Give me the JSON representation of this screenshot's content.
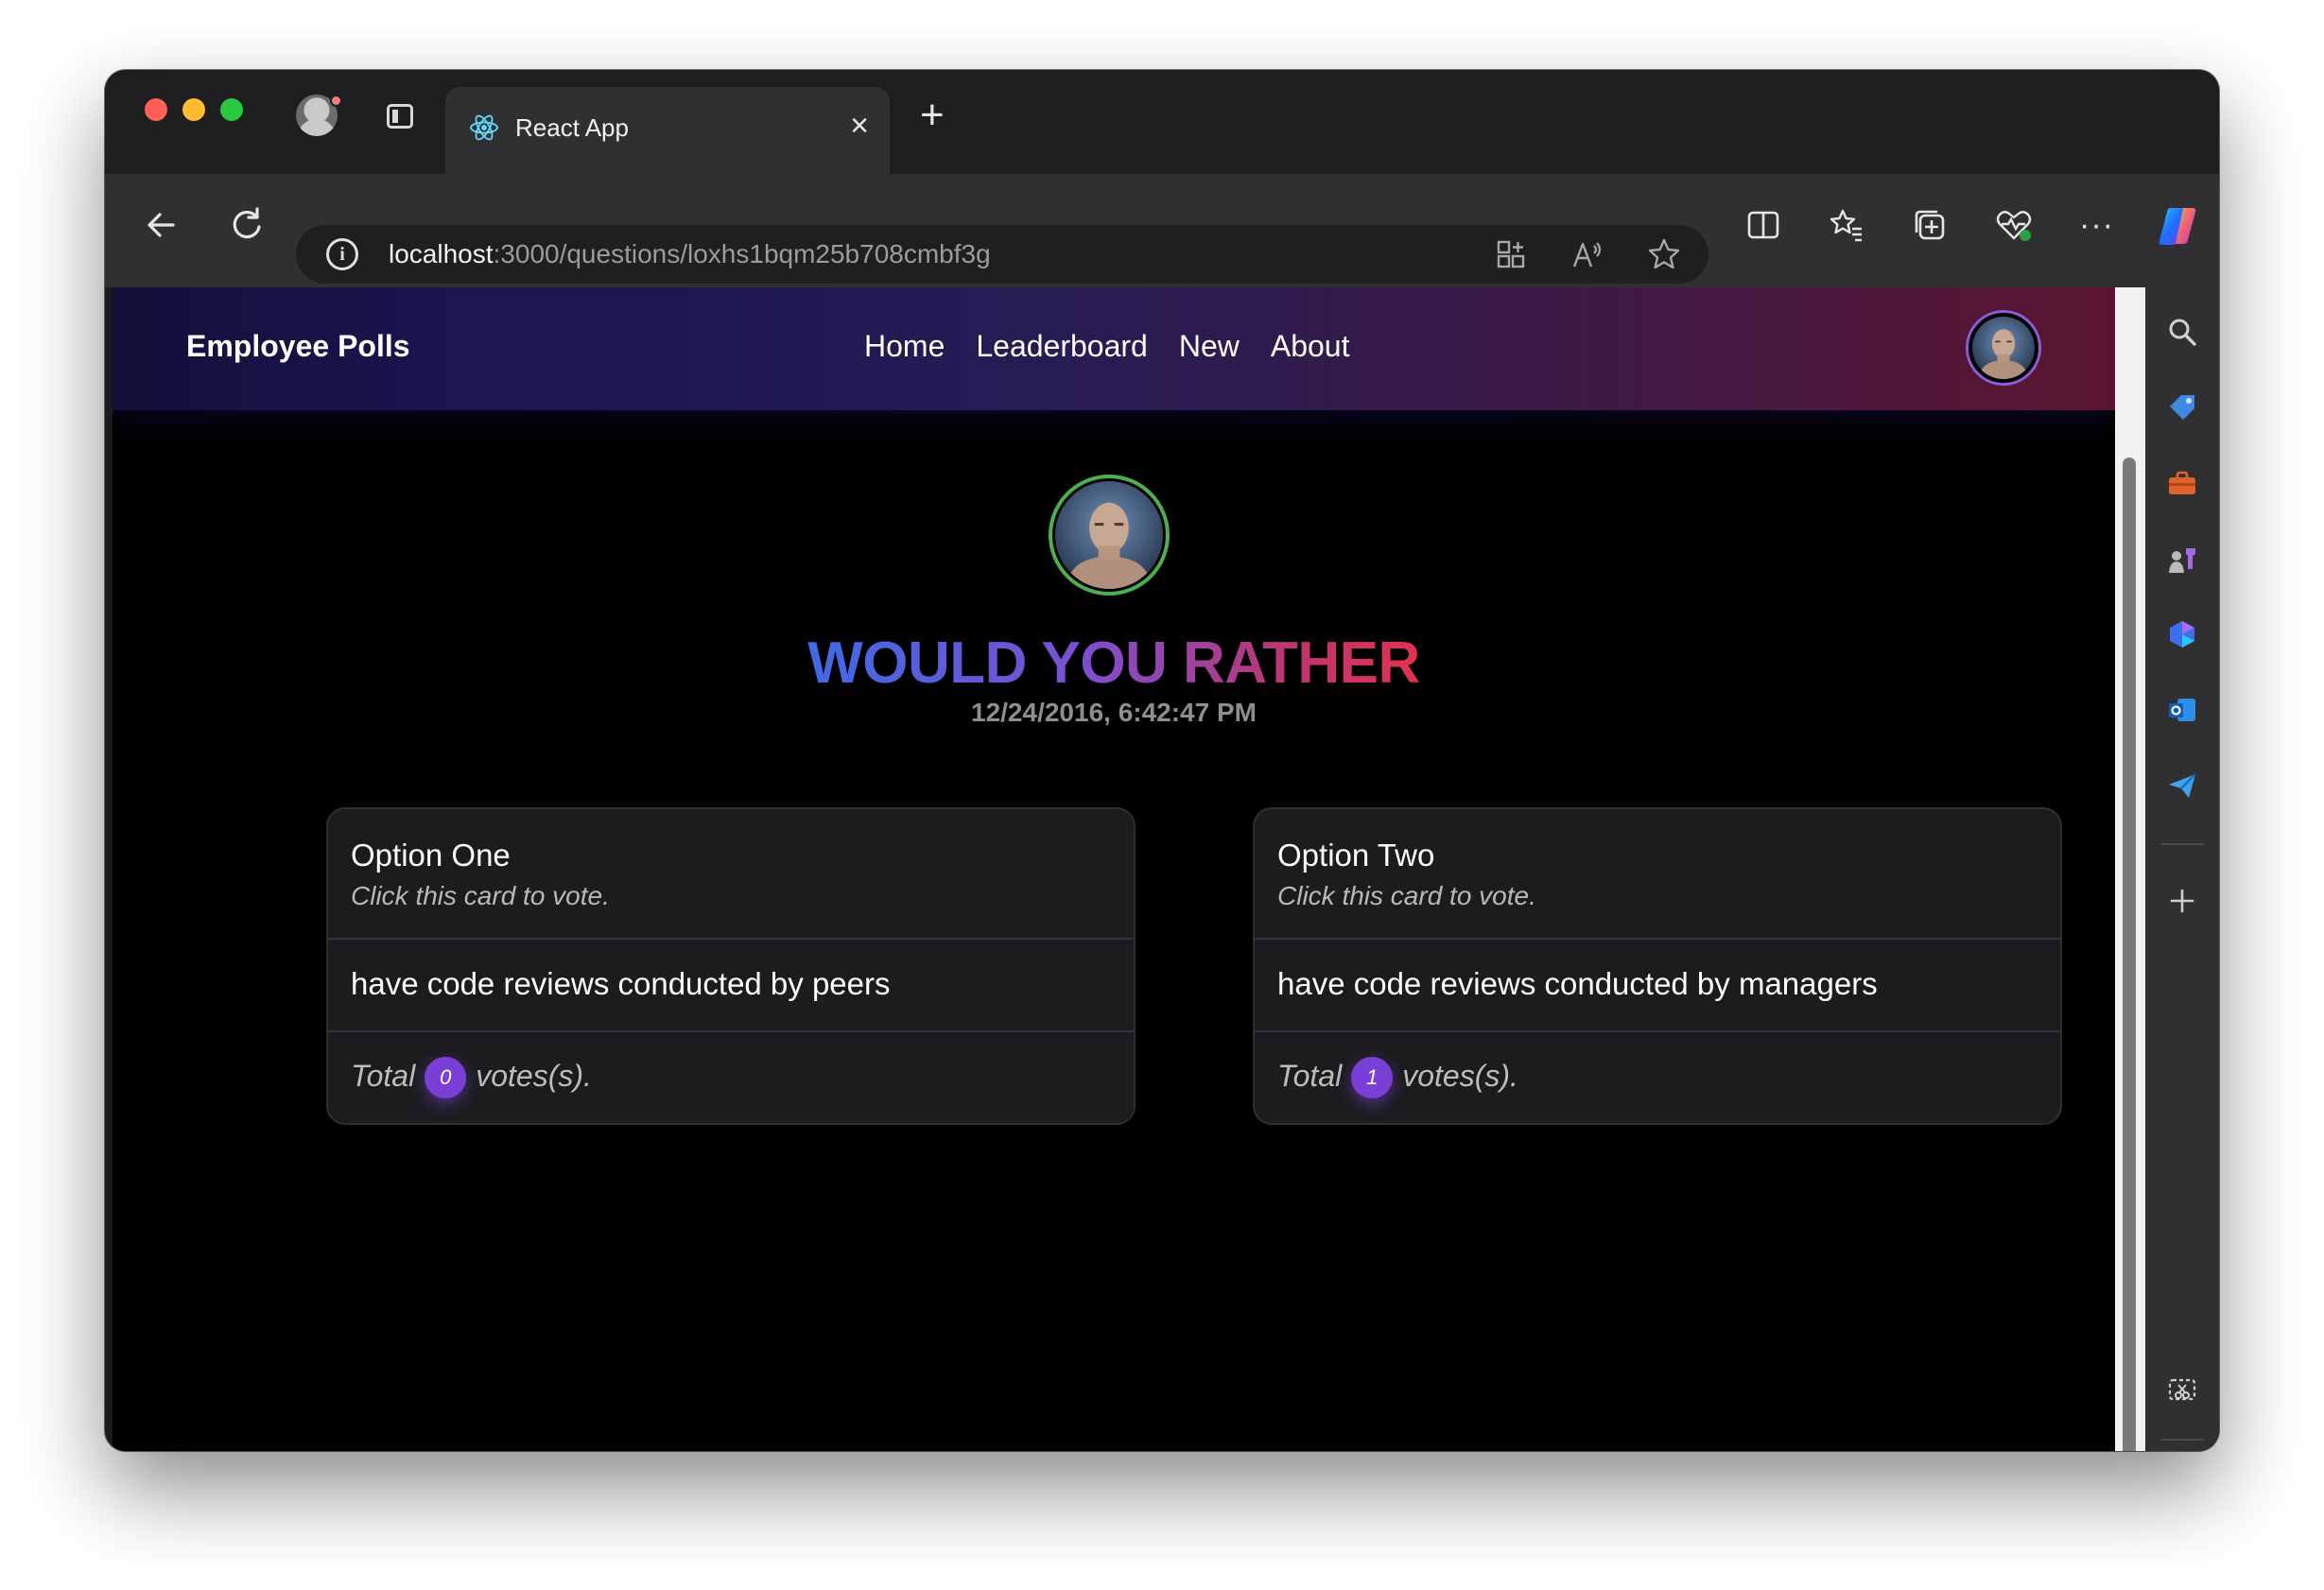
{
  "browser": {
    "tab_title": "React App",
    "tab_close": "×",
    "new_tab": "+",
    "url_host": "localhost",
    "url_rest": ":3000/questions/loxhs1bqm25b708cmbf3g",
    "info_glyph": "i",
    "more_glyph": "···"
  },
  "icons": {
    "back": "back-arrow-icon",
    "reload": "reload-icon",
    "apps": "apps-icon",
    "read_aloud": "read-aloud-icon",
    "favorite": "star-icon",
    "split": "split-screen-icon",
    "favorites": "favorites-icon",
    "collections": "collections-icon",
    "health": "browser-essentials-icon",
    "copilot": "copilot-icon"
  },
  "app": {
    "brand": "Employee Polls",
    "nav": [
      "Home",
      "Leaderboard",
      "New",
      "About"
    ]
  },
  "question": {
    "heading": "WOULD YOU RATHER",
    "timestamp": "12/24/2016, 6:42:47 PM",
    "options": [
      {
        "title": "Option One",
        "hint": "Click this card to vote.",
        "text": "have code reviews conducted by peers",
        "total_prefix": "Total",
        "votes": "0",
        "total_suffix": "votes(s)."
      },
      {
        "title": "Option Two",
        "hint": "Click this card to vote.",
        "text": "have code reviews conducted by managers",
        "total_prefix": "Total",
        "votes": "1",
        "total_suffix": "votes(s)."
      }
    ]
  },
  "colors": {
    "accent_purple": "#7a3fd6",
    "avatar_ring_green": "#4caf50",
    "heading_gradient": [
      "#3f6ae6",
      "#7c4fd0",
      "#e2324e"
    ]
  }
}
